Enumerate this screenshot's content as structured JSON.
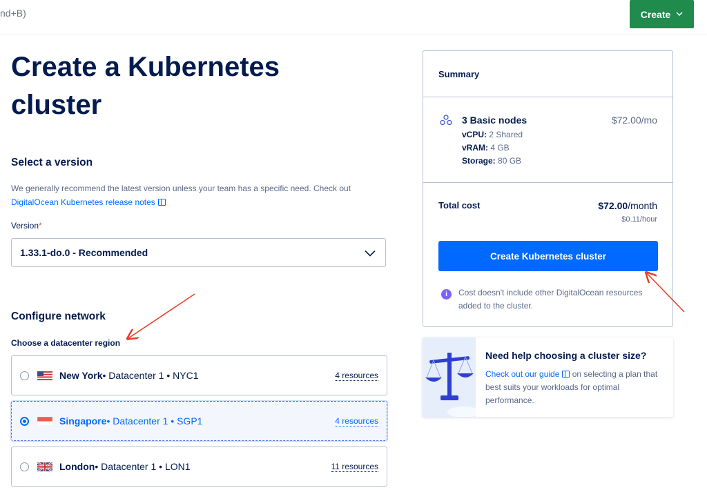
{
  "topbar": {
    "search_hint": "nd+B)",
    "create_label": "Create"
  },
  "page": {
    "title": "Create a Kubernetes cluster"
  },
  "version_section": {
    "title": "Select a version",
    "description": "We generally recommend the latest version unless your team has a specific need. Check out",
    "link_text": "DigitalOcean Kubernetes release notes",
    "field_label": "Version",
    "required_mark": "*",
    "selected_value": "1.33.1-do.0 - Recommended"
  },
  "network_section": {
    "title": "Configure network",
    "region_label": "Choose a datacenter region",
    "regions": [
      {
        "name": "New York",
        "meta": " • Datacenter 1 • NYC1",
        "resources": "4 resources",
        "selected": false,
        "flag": "us-flag"
      },
      {
        "name": "Singapore",
        "meta": " • Datacenter 1 • SGP1",
        "resources": "4 resources",
        "selected": true,
        "flag": "sg-flag"
      },
      {
        "name": "London",
        "meta": " • Datacenter 1 • LON1",
        "resources": "11 resources",
        "selected": false,
        "flag": "uk-flag"
      }
    ]
  },
  "summary": {
    "title": "Summary",
    "nodes_title": "3 Basic nodes",
    "nodes_price": "$72.00/mo",
    "vcpu_label": "vCPU:",
    "vcpu_value": " 2 Shared",
    "vram_label": "vRAM:",
    "vram_value": " 4 GB",
    "storage_label": "Storage:",
    "storage_value": " 80 GB",
    "total_label": "Total cost",
    "total_amount": "$72.00",
    "total_unit": "/month",
    "hourly": "$0.11/hour",
    "create_button": "Create Kubernetes cluster",
    "note": "Cost doesn't include other DigitalOcean resources added to the cluster."
  },
  "help_card": {
    "title": "Need help choosing a cluster size?",
    "link_text": "Check out our guide",
    "text": " on selecting a plan that best suits your workloads for optimal performance."
  },
  "colors": {
    "primary": "#0069ff",
    "create_green": "#1f8b4c",
    "text_dark": "#031b4e",
    "annotation_red": "#e8402b"
  }
}
